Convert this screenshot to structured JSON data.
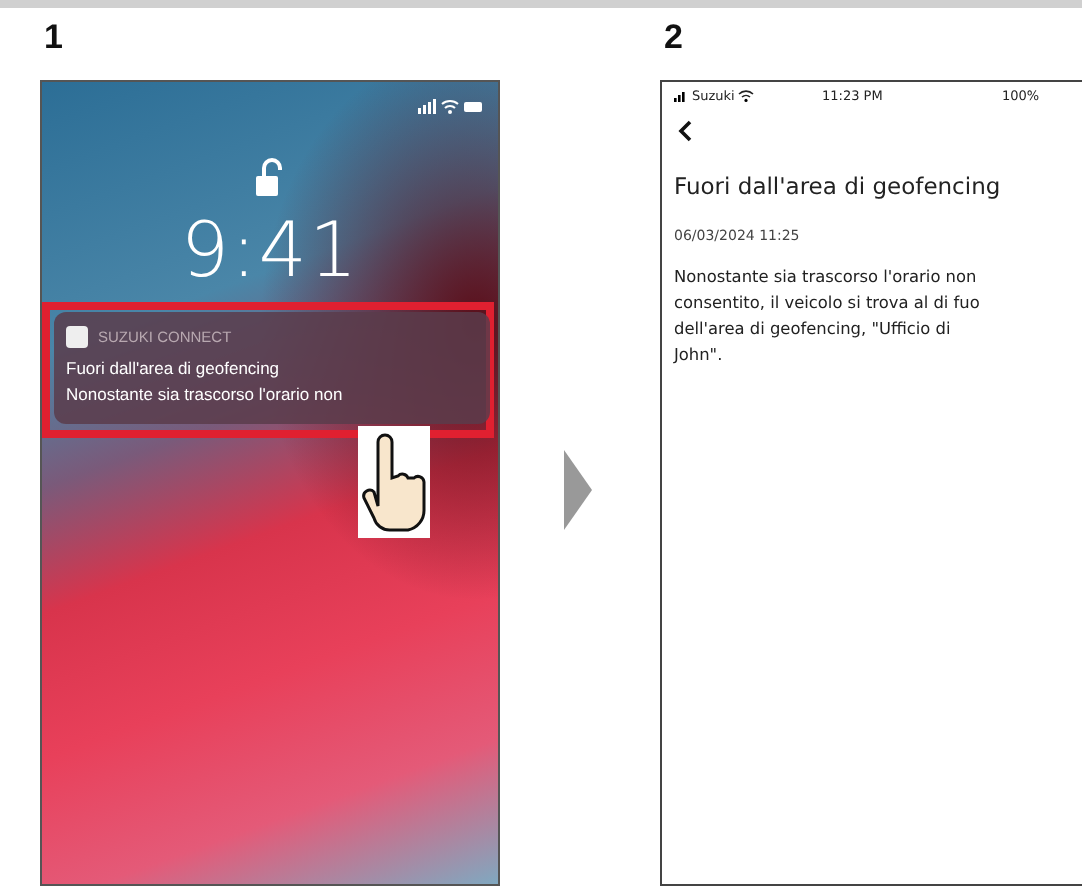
{
  "lock_screen_step": {
    "number": "1",
    "time": "9:41",
    "notification": {
      "app": "SUZUKI CONNECT",
      "title": "Fuori dall'area di geofencing",
      "body": "Nonostante sia trascorso l'orario non"
    }
  },
  "app_step": {
    "number": "2",
    "status_bar": {
      "carrier": "Suzuki",
      "time": "11:23 PM",
      "battery": "100%"
    },
    "title": "Fuori dall'area di geofencing",
    "date": "06/03/2024 11:25",
    "body_lines": [
      "Nonostante sia trascorso l'orario non",
      "consentito, il veicolo si trova al di fuo",
      "dell'area di geofencing, \"Ufficio di",
      "John\"."
    ]
  }
}
